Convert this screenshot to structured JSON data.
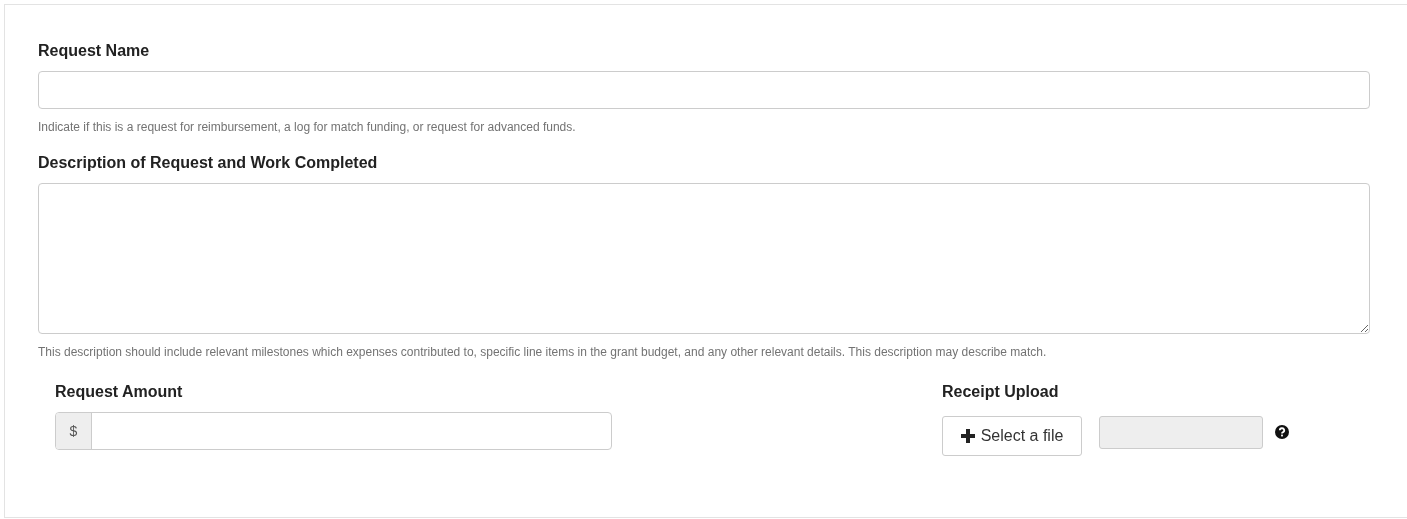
{
  "request_name": {
    "label": "Request Name",
    "help": "Indicate if this is a request for reimbursement, a log for match funding, or request for advanced funds."
  },
  "description": {
    "label": "Description of Request and Work Completed",
    "help": "This description should include relevant milestones which expenses contributed to, specific line items in the grant budget, and any other relevant details. This description may describe match."
  },
  "request_amount": {
    "label": "Request Amount",
    "prefix": "$"
  },
  "receipt_upload": {
    "label": "Receipt Upload",
    "button": "Select a file",
    "file_field_disabled": true
  }
}
